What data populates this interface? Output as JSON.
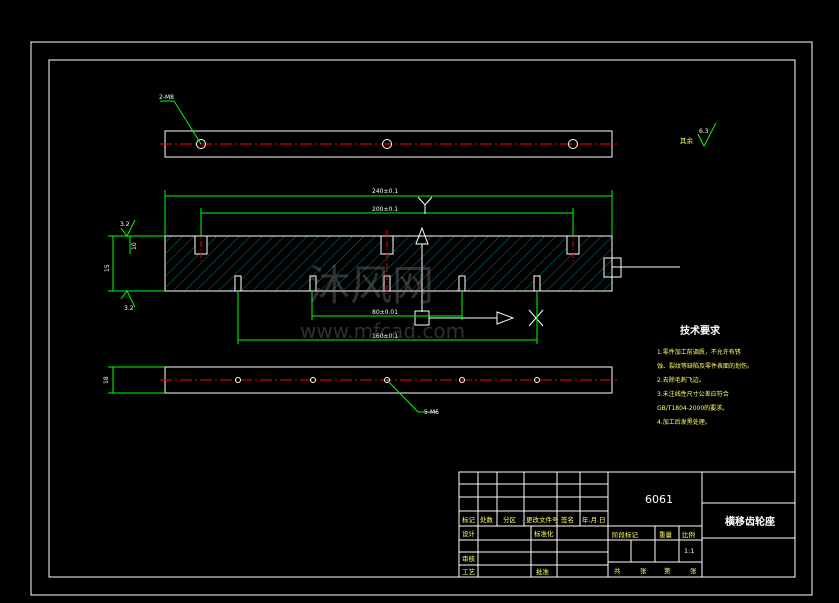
{
  "colors": {
    "background": "#000000",
    "frame": "#ffffff",
    "part_outline": "#ffffff",
    "center_line": "#ff0000",
    "dimension": "#00ff00",
    "hatch": "#00aaaa",
    "title_block": "#ffffff"
  },
  "hole_callouts": {
    "top": "2-M8",
    "bottom": "5-M6"
  },
  "roughness": {
    "rest_label": "其余",
    "rest_value": "6.3",
    "top_value": "3.2",
    "bottom_value": "3.2"
  },
  "dimensions": {
    "overall_length": "240±0.1",
    "hole_span": "200±0.1",
    "slot_pitch": "80±0.01",
    "bottom_span": "160±0.1",
    "height": "10",
    "thickness": "18",
    "height_tol": "15",
    "datum_a": "A"
  },
  "watermark": {
    "chinese": "沐风网",
    "url": "www.mfcad.com"
  },
  "tech_requirements": {
    "title": "技术要求",
    "lines": [
      "1.零件加工前调质，不允许有锈",
      "蚀、裂纹等缺陷及零件表面的划伤。",
      "2.去除毛刺飞边。",
      "3.未注线性尺寸公差应符合",
      "GB/T1804-2000的要求。",
      "4.加工后发黑处理。"
    ]
  },
  "title_block": {
    "material": "6061",
    "part_name": "横移齿轮座",
    "scale": "1:1",
    "headers_row1": [
      "标记",
      "处数",
      "分区",
      "更改文件号",
      "签名",
      "年.月.日"
    ],
    "design": "设计",
    "standardize": "标准化",
    "check": "审核",
    "process": "工艺",
    "approve": "批准",
    "stage_mark": "阶段标记",
    "weight": "重量",
    "scale_label": "比例",
    "sheet_total": "共",
    "sheet_unit": "张",
    "sheet_no": "第",
    "sheet_unit2": "张"
  }
}
